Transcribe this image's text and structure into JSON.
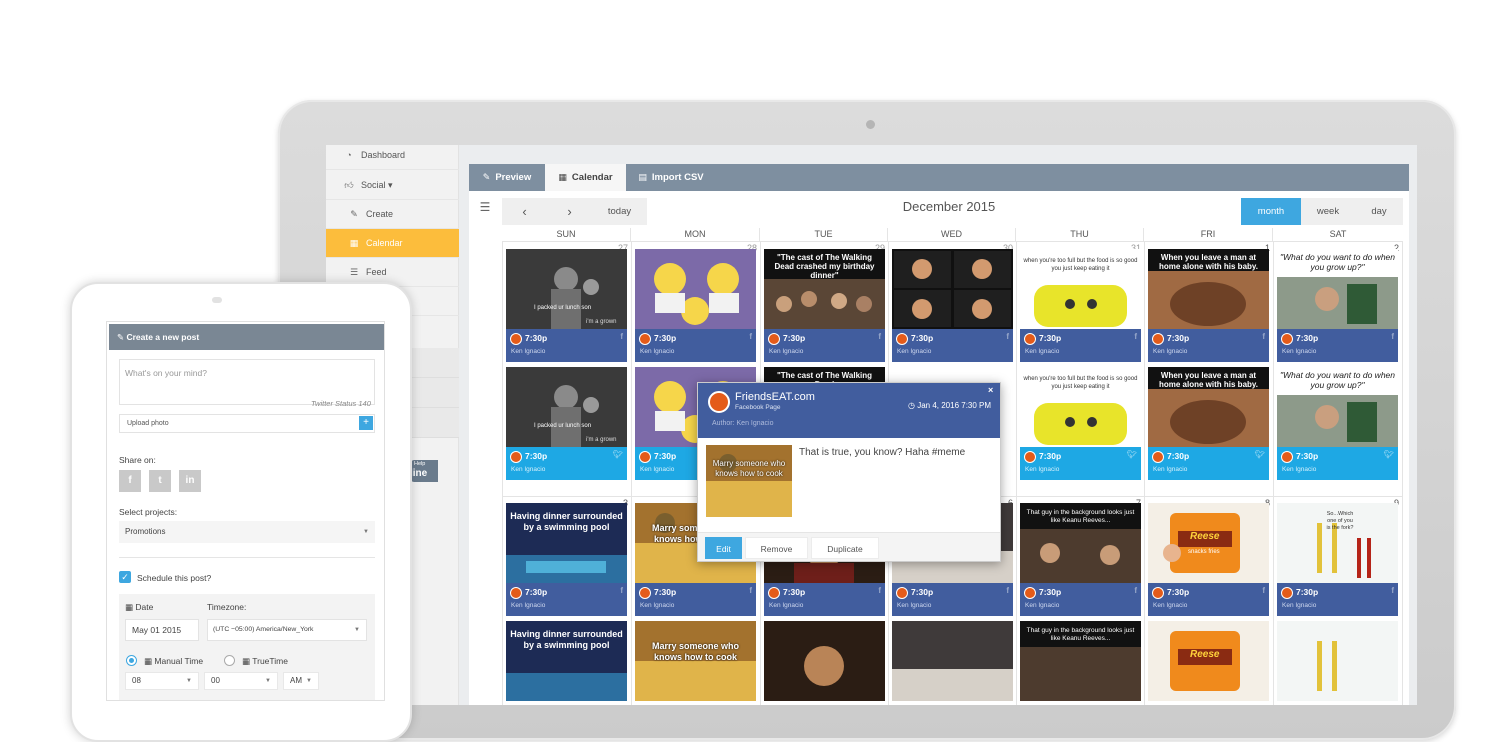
{
  "sidebar": {
    "items": [
      {
        "label": "Dashboard",
        "icon": "tachometer-icon"
      },
      {
        "label": "Social ▾",
        "icon": "thumbs-up-icon"
      },
      {
        "label": "Create",
        "icon": "pencil-icon"
      },
      {
        "label": "Calendar",
        "icon": "calendar-icon",
        "active": true
      },
      {
        "label": "Feed",
        "icon": "list-icon"
      }
    ]
  },
  "tabs": [
    {
      "label": "Preview",
      "icon": "edit-icon"
    },
    {
      "label": "Calendar",
      "icon": "calendar-icon",
      "active": true
    },
    {
      "label": "Import CSV",
      "icon": "file-icon"
    }
  ],
  "calendar": {
    "nav": {
      "prev": "‹",
      "next": "›",
      "today": "today"
    },
    "title": "December 2015",
    "views": [
      {
        "label": "month",
        "active": true
      },
      {
        "label": "week"
      },
      {
        "label": "day"
      }
    ],
    "days_of_week": [
      "SUN",
      "MON",
      "TUE",
      "WED",
      "THU",
      "FRI",
      "SAT"
    ],
    "week_day_numbers": [
      [
        "27",
        "28",
        "29",
        "30",
        "31",
        "1",
        "2"
      ],
      [
        "",
        "",
        "",
        "",
        "",
        "",
        ""
      ],
      [
        "3",
        "",
        "",
        "6",
        "7",
        "8",
        "9"
      ]
    ],
    "post_time": "7:30p",
    "post_author": "Ken Ignacio",
    "captions": {
      "tue_row1": "\"The cast of The Walking Dead crashed my birthday dinner\"",
      "tue_row2": "\"The cast of The Walking Dead",
      "thu_row1": "when you're too full but the food is so good you just keep eating it",
      "fri_row1": "When you leave a man at home alone with his baby.",
      "sat_row1": "\"What do you want to do when you grow up?\"",
      "sun_row3": "Having dinner surrounded by a swimming pool",
      "mon_row3": "Marry someone who knows how to cook",
      "thu_row3": "That guy in the background looks just like Keanu Reeves...",
      "sat_row3": "So...Which one of you is the fork?",
      "sun_row1_img": "I packed ur lunch son",
      "sun_row1_img2": "i'm a grown",
      "fri_row3_img": "Reese",
      "fri_row3_img2": "snacks fries"
    }
  },
  "popup": {
    "page_name": "FriendsEAT.com",
    "page_type": "Facebook Page",
    "author": "Author: Ken Ignacio",
    "date": "Jan 4, 2016 7:30 PM",
    "text": "That is true, you know? Haha #meme",
    "image_caption": "Marry someone who knows how to cook",
    "buttons": [
      "Edit",
      "Remove",
      "Duplicate"
    ]
  },
  "help_tab": {
    "top": "Help",
    "bottom": "line"
  },
  "phone": {
    "header": "Create a new post",
    "placeholder": "What's on your mind?",
    "twitter_status": "Twitter Status 140",
    "upload_label": "Upload photo",
    "share_label": "Share on:",
    "share_networks": [
      "f",
      "t",
      "in"
    ],
    "projects_label": "Select projects:",
    "project_value": "Promotions",
    "schedule_label": "Schedule this post?",
    "date_label": "Date",
    "timezone_label": "Timezone:",
    "date_value": "May 01 2015",
    "timezone_value": "(UTC −05:00) America/New_York",
    "manual_time_label": "Manual Time",
    "true_time_label": "TrueTime",
    "hour": "08",
    "minute": "00",
    "ampm": "AM"
  },
  "colors": {
    "accent_blue": "#3ea7e0",
    "facebook_blue": "#415d9e",
    "twitter_blue": "#1ea8e4",
    "active_orange": "#fcbd3c",
    "tab_bar_gray": "#7e8fa0"
  }
}
